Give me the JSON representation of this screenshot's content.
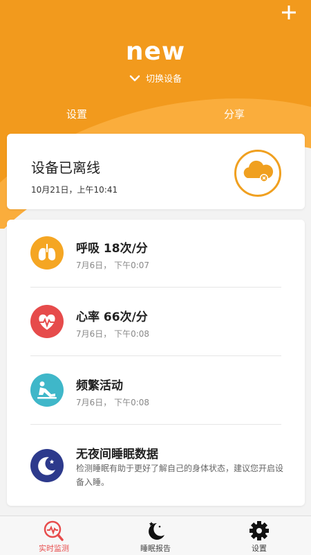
{
  "header": {
    "device_name": "new",
    "switch_device_label": "切换设备",
    "settings_link": "设置",
    "share_link": "分享",
    "add_icon": "plus-icon"
  },
  "status_card": {
    "title": "设备已离线",
    "timestamp": "10月21日，上午10:41",
    "icon": "cloud-offline-icon"
  },
  "items": [
    {
      "title": "呼吸 18次/分",
      "time": "7月6日，  下午0:07",
      "icon": "lungs-icon",
      "color": "#f5a623"
    },
    {
      "title": "心率 66次/分",
      "time": "7月6日，  下午0:08",
      "icon": "heart-rate-icon",
      "color": "#e64b4b"
    },
    {
      "title": "频繁活动",
      "time": "7月6日，  下午0:08",
      "icon": "activity-icon",
      "color": "#3fb7c9"
    },
    {
      "title": "无夜间睡眠数据",
      "description": "检测睡眠有助于更好了解自己的身体状态，建议您开启设备入睡。",
      "icon": "moon-icon",
      "color": "#2d3a8c"
    }
  ],
  "tabs": [
    {
      "label": "实时监测",
      "icon": "monitor-icon",
      "active": true
    },
    {
      "label": "睡眠报告",
      "icon": "sleep-report-icon",
      "active": false
    },
    {
      "label": "设置",
      "icon": "gear-icon",
      "active": false
    }
  ],
  "colors": {
    "primary": "#f29a1d",
    "active_tab": "#e74c4c"
  }
}
